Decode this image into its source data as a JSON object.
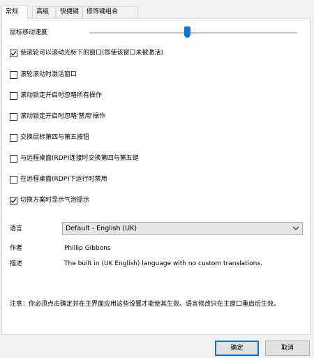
{
  "tabs": [
    {
      "label": "常规"
    },
    {
      "label": "高级"
    },
    {
      "label": "快捷键"
    },
    {
      "label": "修饰键组合"
    }
  ],
  "mouse_speed": {
    "label": "鼠标移动速度",
    "value": 0.47
  },
  "options": [
    {
      "label": "使滚轮可以滚动光标下的窗口(即使该窗口未被激活)",
      "checked": true
    },
    {
      "label": "滚轮滚动时激活窗口",
      "checked": false
    },
    {
      "label": "滚动锁定开启时忽略所有操作",
      "checked": false
    },
    {
      "label": "滚动锁定开启时忽略'禁用'操作",
      "checked": false
    },
    {
      "label": "交换鼠标第四与第五按钮",
      "checked": false
    },
    {
      "label": "与远程桌面(RDP)连接时交换第四与第五键",
      "checked": false
    },
    {
      "label": "在远程桌面(RDP)下运行时禁用",
      "checked": false
    },
    {
      "label": "切换方案时显示气泡提示",
      "checked": true
    }
  ],
  "language": {
    "label": "语言",
    "selected": "Default - English (UK)"
  },
  "author": {
    "label": "作者",
    "value": "Phillip Gibbons"
  },
  "description": {
    "label": "描述",
    "value": "The built in (UK English) language with no custom translations."
  },
  "note": "注意：你必须点击确定并在主界面应用这些设置才能使其生效。语言修改只在主窗口重启后生效。",
  "buttons": {
    "ok": "确定",
    "cancel": "取消"
  },
  "colors": {
    "accent": "#0078d7",
    "slider_thumb": "#0a74d9"
  }
}
